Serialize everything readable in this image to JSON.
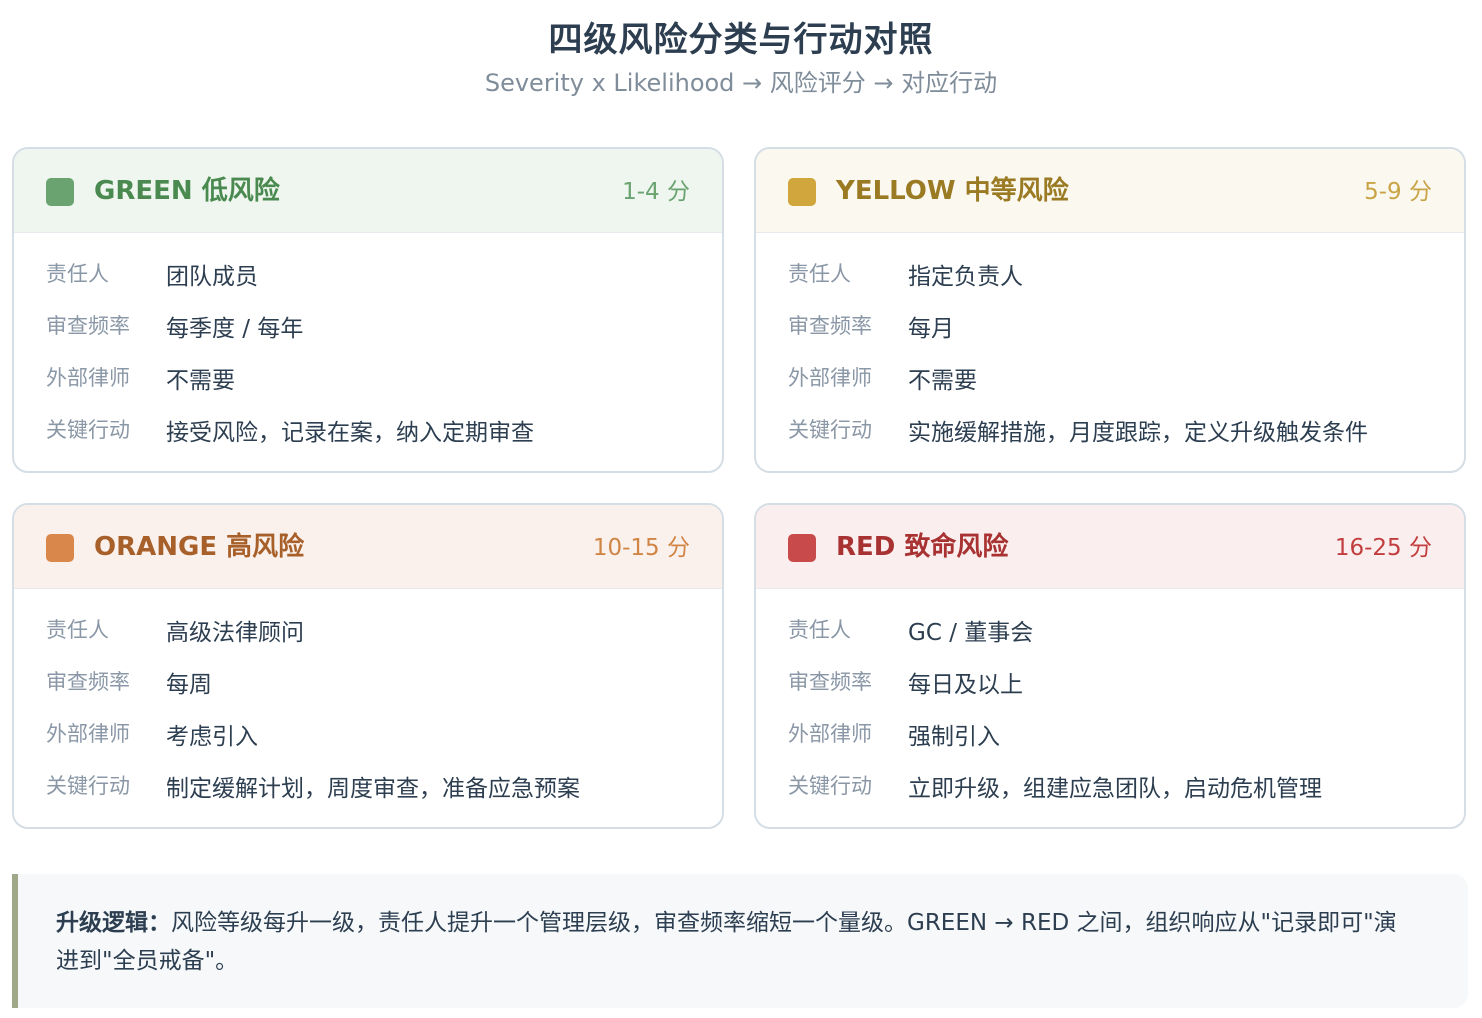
{
  "header": {
    "title": "四级风险分类与行动对照",
    "subtitle": "Severity x Likelihood → 风险评分 → 对应行动"
  },
  "row_labels": {
    "owner": "责任人",
    "frequency": "审查频率",
    "counsel": "外部律师",
    "action": "关键行动"
  },
  "cards": {
    "green": {
      "name": "GREEN 低风险",
      "score": "1-4 分",
      "owner": "团队成员",
      "frequency": "每季度 / 每年",
      "counsel": "不需要",
      "action": "接受风险，记录在案，纳入定期审查",
      "colors": {
        "swatch": "#6aa36f",
        "text": "#4a8a50",
        "score": "#6aa36f",
        "head_bg": "#eef6ef"
      }
    },
    "yellow": {
      "name": "YELLOW 中等风险",
      "score": "5-9 分",
      "owner": "指定负责人",
      "frequency": "每月",
      "counsel": "不需要",
      "action": "实施缓解措施，月度跟踪，定义升级触发条件",
      "colors": {
        "swatch": "#d1a63c",
        "text": "#9a7a22",
        "score": "#c9a447",
        "head_bg": "#fbf8ef"
      }
    },
    "orange": {
      "name": "ORANGE 高风险",
      "score": "10-15 分",
      "owner": "高级法律顾问",
      "frequency": "每周",
      "counsel": "考虑引入",
      "action": "制定缓解计划，周度审查，准备应急预案",
      "colors": {
        "swatch": "#d9874a",
        "text": "#a8602a",
        "score": "#d08545",
        "head_bg": "#fbf1ec"
      }
    },
    "red": {
      "name": "RED 致命风险",
      "score": "16-25 分",
      "owner": "GC / 董事会",
      "frequency": "每日及以上",
      "counsel": "强制引入",
      "action": "立即升级，组建应急团队，启动危机管理",
      "colors": {
        "swatch": "#c94a4a",
        "text": "#a83232",
        "score": "#c23e3e",
        "head_bg": "#fbeeee"
      }
    }
  },
  "note": {
    "label": "升级逻辑：",
    "text": "风险等级每升一级，责任人提升一个管理层级，审查频率缩短一个量级。GREEN → RED 之间，组织响应从\"记录即可\"演进到\"全员戒备\"。"
  }
}
